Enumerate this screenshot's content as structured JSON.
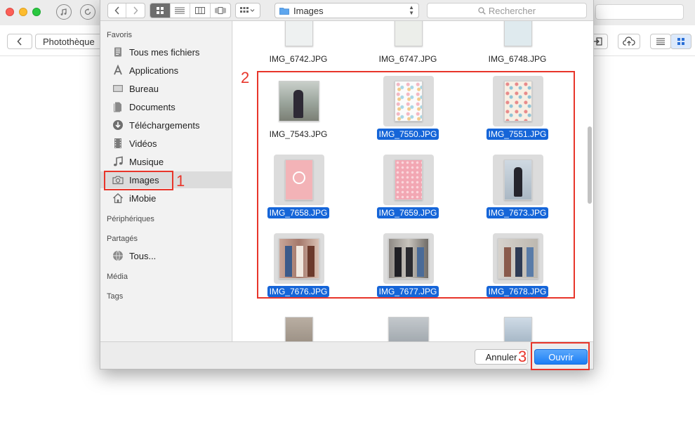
{
  "background_app": {
    "breadcrumb": "Photothèque",
    "accent": "#dce9fb"
  },
  "dialog": {
    "location": "Images",
    "search_placeholder": "Rechercher",
    "sidebar": {
      "favoris_header": "Favoris",
      "items": [
        {
          "label": "Tous mes fichiers",
          "icon": "all-files-icon"
        },
        {
          "label": "Applications",
          "icon": "applications-icon"
        },
        {
          "label": "Bureau",
          "icon": "desktop-icon"
        },
        {
          "label": "Documents",
          "icon": "documents-icon"
        },
        {
          "label": "Téléchargements",
          "icon": "downloads-icon"
        },
        {
          "label": "Vidéos",
          "icon": "videos-icon"
        },
        {
          "label": "Musique",
          "icon": "music-icon"
        },
        {
          "label": "Images",
          "icon": "camera-icon",
          "selected": true
        },
        {
          "label": "iMobie",
          "icon": "home-icon"
        }
      ],
      "peripheriques_header": "Périphériques",
      "partages_header": "Partagés",
      "shared_item": "Tous...",
      "media_header": "Média",
      "tags_header": "Tags"
    },
    "files_top": [
      {
        "name": "IMG_6742.JPG",
        "selected": false
      },
      {
        "name": "IMG_6747.JPG",
        "selected": false
      },
      {
        "name": "IMG_6748.JPG",
        "selected": false
      }
    ],
    "files": [
      {
        "name": "IMG_7543.JPG",
        "selected": false
      },
      {
        "name": "IMG_7550.JPG",
        "selected": true
      },
      {
        "name": "IMG_7551.JPG",
        "selected": true
      },
      {
        "name": "IMG_7658.JPG",
        "selected": true
      },
      {
        "name": "IMG_7659.JPG",
        "selected": true
      },
      {
        "name": "IMG_7673.JPG",
        "selected": true
      },
      {
        "name": "IMG_7676.JPG",
        "selected": true
      },
      {
        "name": "IMG_7677.JPG",
        "selected": true
      },
      {
        "name": "IMG_7678.JPG",
        "selected": true
      }
    ],
    "cancel_label": "Annuler",
    "open_label": "Ouvrir"
  },
  "annotations": {
    "step1": "1",
    "step2": "2",
    "step3": "3",
    "color": "#e8352a"
  },
  "selection_color": "#1565d8"
}
